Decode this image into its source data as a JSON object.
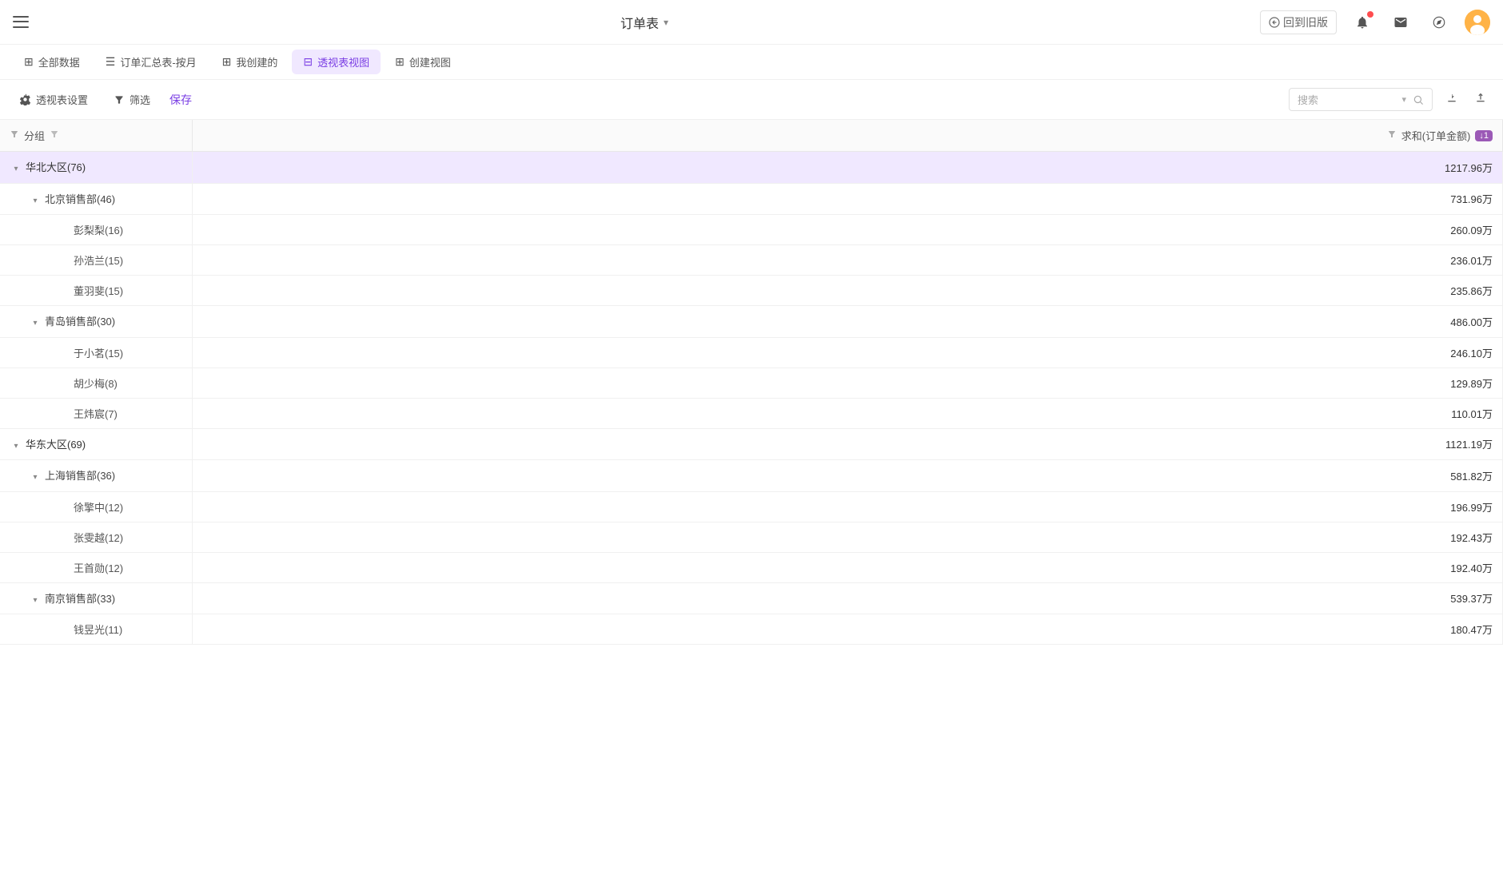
{
  "header": {
    "menu_label": "菜单",
    "title": "订单表",
    "dropdown_label": "订单表",
    "return_label": "回到旧版",
    "notifications_icon": "bell-icon",
    "mail_icon": "mail-icon",
    "settings_icon": "settings-icon",
    "avatar_icon": "avatar-icon"
  },
  "tabs": [
    {
      "id": "all-data",
      "label": "全部数据",
      "icon": "grid",
      "active": false
    },
    {
      "id": "order-summary",
      "label": "订单汇总表-按月",
      "icon": "table",
      "active": false
    },
    {
      "id": "my-created",
      "label": "我创建的",
      "icon": "grid",
      "active": false
    },
    {
      "id": "pivot-view",
      "label": "透视表视图",
      "icon": "pivot",
      "active": true
    },
    {
      "id": "create-view",
      "label": "创建视图",
      "icon": "plus",
      "active": false
    }
  ],
  "toolbar": {
    "settings_label": "透视表设置",
    "filter_label": "筛选",
    "save_label": "保存",
    "search_placeholder": "搜索"
  },
  "table": {
    "col1_header": "分组",
    "col2_header": "求和(订单金额)",
    "col2_sort_badge": "↓1",
    "rows": [
      {
        "id": "r1",
        "indent": 0,
        "expandable": true,
        "expanded": true,
        "label": "华北大区(76)",
        "value": "1217.96万",
        "type": "region",
        "selected": true
      },
      {
        "id": "r2",
        "indent": 1,
        "expandable": true,
        "expanded": true,
        "label": "北京销售部(46)",
        "value": "731.96万",
        "type": "dept"
      },
      {
        "id": "r3",
        "indent": 2,
        "expandable": false,
        "expanded": false,
        "label": "彭梨梨(16)",
        "value": "260.09万",
        "type": "person"
      },
      {
        "id": "r4",
        "indent": 2,
        "expandable": false,
        "expanded": false,
        "label": "孙浩兰(15)",
        "value": "236.01万",
        "type": "person"
      },
      {
        "id": "r5",
        "indent": 2,
        "expandable": false,
        "expanded": false,
        "label": "董羽斐(15)",
        "value": "235.86万",
        "type": "person"
      },
      {
        "id": "r6",
        "indent": 1,
        "expandable": true,
        "expanded": true,
        "label": "青岛销售部(30)",
        "value": "486.00万",
        "type": "dept"
      },
      {
        "id": "r7",
        "indent": 2,
        "expandable": false,
        "expanded": false,
        "label": "于小茗(15)",
        "value": "246.10万",
        "type": "person"
      },
      {
        "id": "r8",
        "indent": 2,
        "expandable": false,
        "expanded": false,
        "label": "胡少梅(8)",
        "value": "129.89万",
        "type": "person"
      },
      {
        "id": "r9",
        "indent": 2,
        "expandable": false,
        "expanded": false,
        "label": "王炜宸(7)",
        "value": "110.01万",
        "type": "person"
      },
      {
        "id": "r10",
        "indent": 0,
        "expandable": true,
        "expanded": true,
        "label": "华东大区(69)",
        "value": "1121.19万",
        "type": "region"
      },
      {
        "id": "r11",
        "indent": 1,
        "expandable": true,
        "expanded": true,
        "label": "上海销售部(36)",
        "value": "581.82万",
        "type": "dept"
      },
      {
        "id": "r12",
        "indent": 2,
        "expandable": false,
        "expanded": false,
        "label": "徐擎中(12)",
        "value": "196.99万",
        "type": "person"
      },
      {
        "id": "r13",
        "indent": 2,
        "expandable": false,
        "expanded": false,
        "label": "张雯越(12)",
        "value": "192.43万",
        "type": "person"
      },
      {
        "id": "r14",
        "indent": 2,
        "expandable": false,
        "expanded": false,
        "label": "王首勋(12)",
        "value": "192.40万",
        "type": "person"
      },
      {
        "id": "r15",
        "indent": 1,
        "expandable": true,
        "expanded": true,
        "label": "南京销售部(33)",
        "value": "539.37万",
        "type": "dept"
      },
      {
        "id": "r16",
        "indent": 2,
        "expandable": false,
        "expanded": false,
        "label": "钱昱光(11)",
        "value": "180.47万",
        "type": "person"
      }
    ]
  }
}
